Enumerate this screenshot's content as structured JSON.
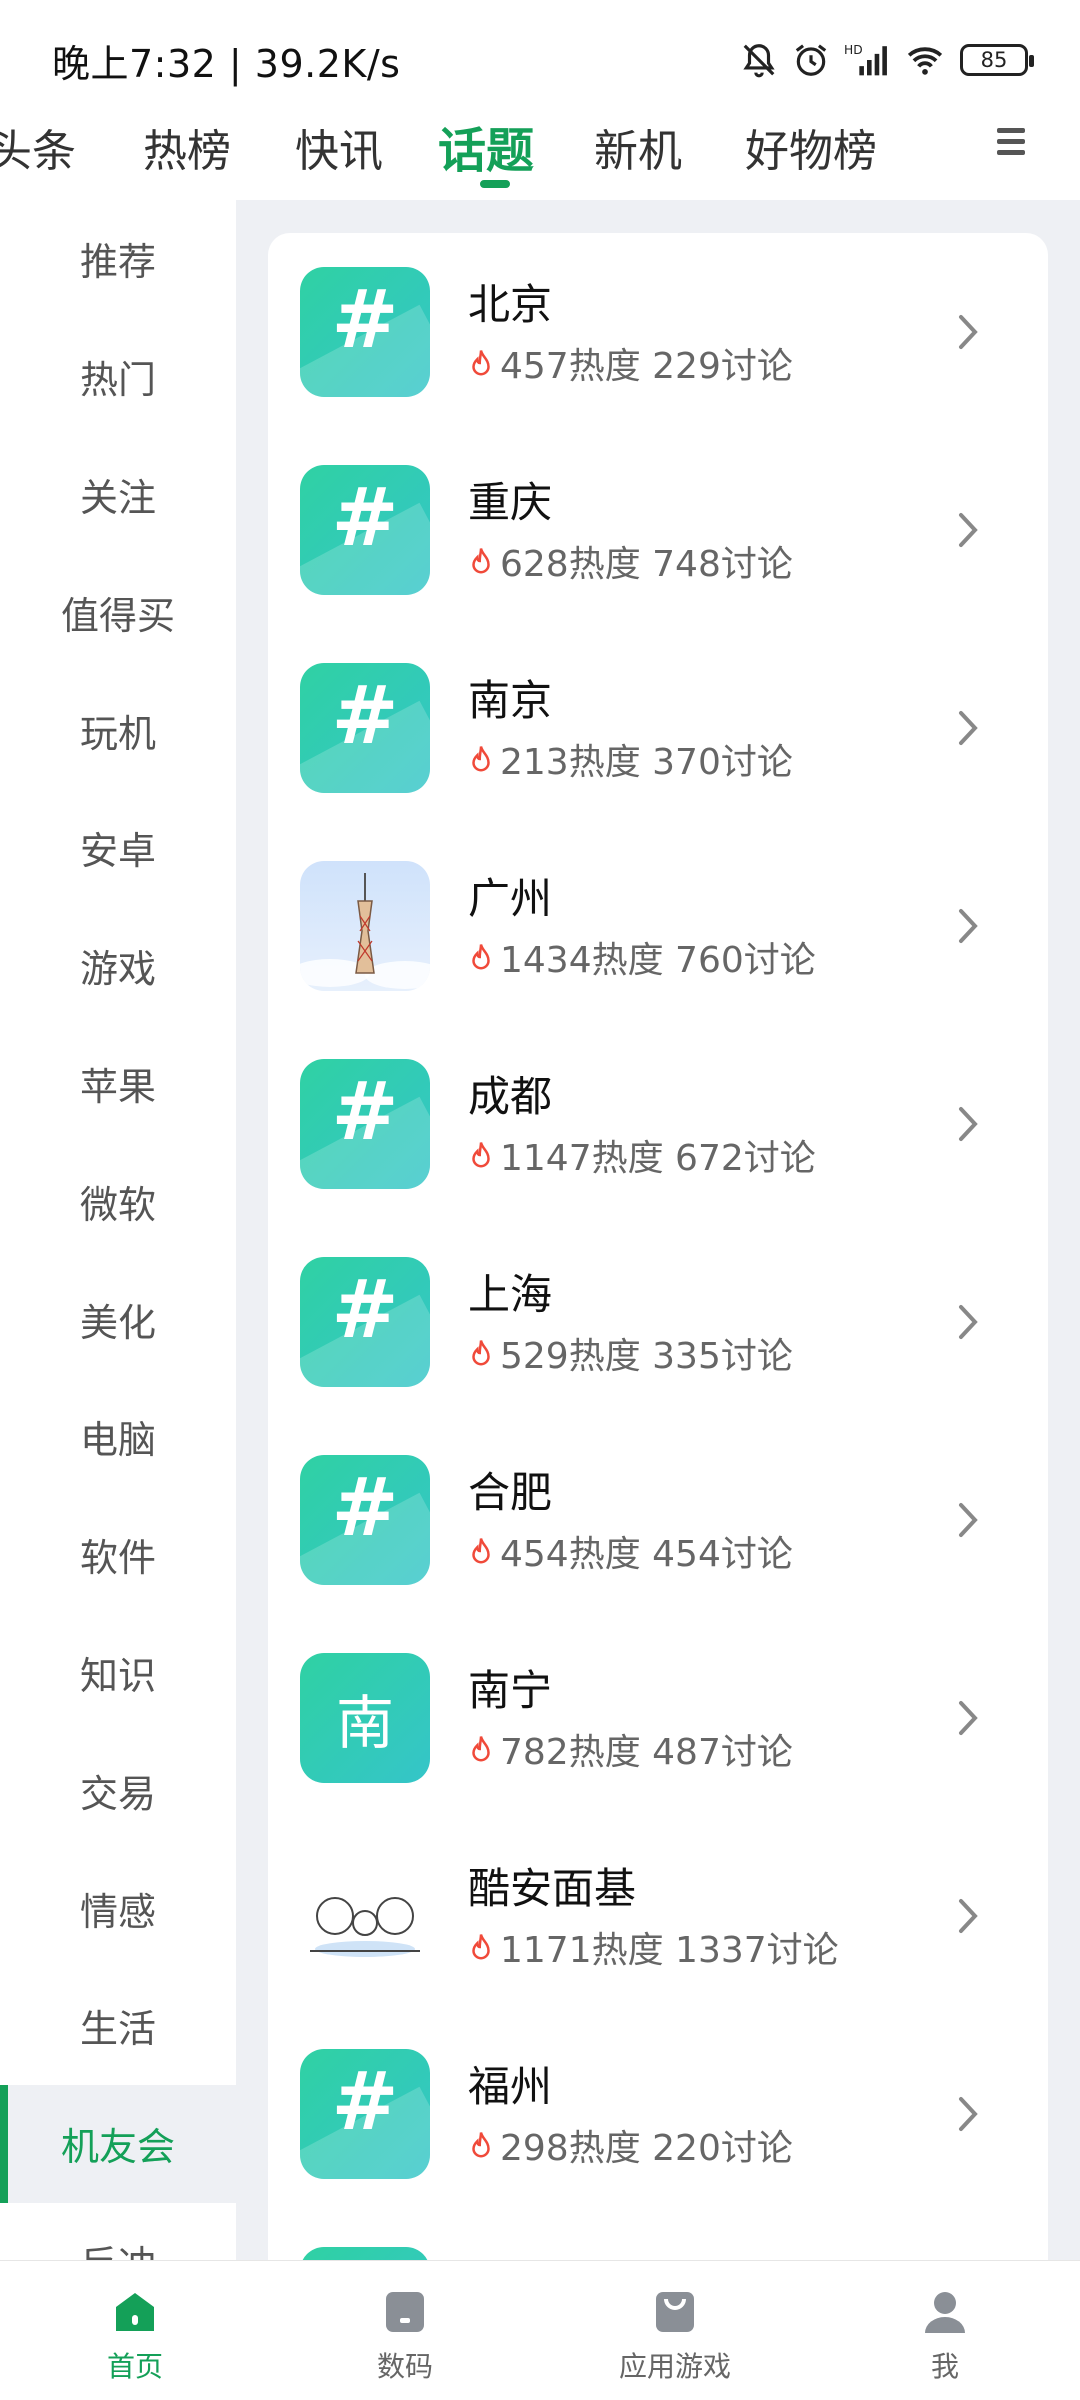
{
  "status_bar": {
    "time_speed": "晚上7:32 | 39.2K/s",
    "battery": "85",
    "icons": [
      "bell-off-icon",
      "alarm-icon",
      "signal-icon",
      "wifi-icon",
      "battery-icon"
    ]
  },
  "top_tabs": [
    {
      "label": "头条"
    },
    {
      "label": "热榜"
    },
    {
      "label": "快讯"
    },
    {
      "label": "话题",
      "active": true
    },
    {
      "label": "新机"
    },
    {
      "label": "好物榜"
    }
  ],
  "sidebar": {
    "items": [
      {
        "label": "推荐"
      },
      {
        "label": "热门"
      },
      {
        "label": "关注"
      },
      {
        "label": "值得买"
      },
      {
        "label": "玩机"
      },
      {
        "label": "安卓"
      },
      {
        "label": "游戏"
      },
      {
        "label": "苹果"
      },
      {
        "label": "微软"
      },
      {
        "label": "美化"
      },
      {
        "label": "电脑"
      },
      {
        "label": "软件"
      },
      {
        "label": "知识"
      },
      {
        "label": "交易"
      },
      {
        "label": "情感"
      },
      {
        "label": "生活"
      },
      {
        "label": "机友会",
        "active": true
      },
      {
        "label": "反冲"
      }
    ]
  },
  "topics": [
    {
      "title": "北京",
      "meta": "457热度 229讨论",
      "icon": "hash-icon"
    },
    {
      "title": "重庆",
      "meta": "628热度 748讨论",
      "icon": "hash-icon"
    },
    {
      "title": "南京",
      "meta": "213热度 370讨论",
      "icon": "hash-icon"
    },
    {
      "title": "广州",
      "meta": "1434热度 760讨论",
      "icon": "canton-tower-icon"
    },
    {
      "title": "成都",
      "meta": "1147热度 672讨论",
      "icon": "hash-icon"
    },
    {
      "title": "上海",
      "meta": "529热度 335讨论",
      "icon": "hash-icon"
    },
    {
      "title": "合肥",
      "meta": "454热度 454讨论",
      "icon": "hash-icon"
    },
    {
      "title": "南宁",
      "meta": "782热度 487讨论",
      "icon": "nan-icon",
      "icon_text": "南"
    },
    {
      "title": "酷安面基",
      "meta": "1171热度 1337讨论",
      "icon": "meme-icon"
    },
    {
      "title": "福州",
      "meta": "298热度 220讨论",
      "icon": "hash-icon"
    },
    {
      "title": "",
      "meta": "",
      "icon": "hash-icon"
    }
  ],
  "bottom_nav": [
    {
      "label": "首页",
      "icon": "home-icon",
      "active": true
    },
    {
      "label": "数码",
      "icon": "digital-icon"
    },
    {
      "label": "应用游戏",
      "icon": "app-store-icon"
    },
    {
      "label": "我",
      "icon": "profile-icon"
    }
  ],
  "colors": {
    "accent": "#14a058",
    "fire": "#f04a3a",
    "panel_bg": "#eef0f4"
  }
}
